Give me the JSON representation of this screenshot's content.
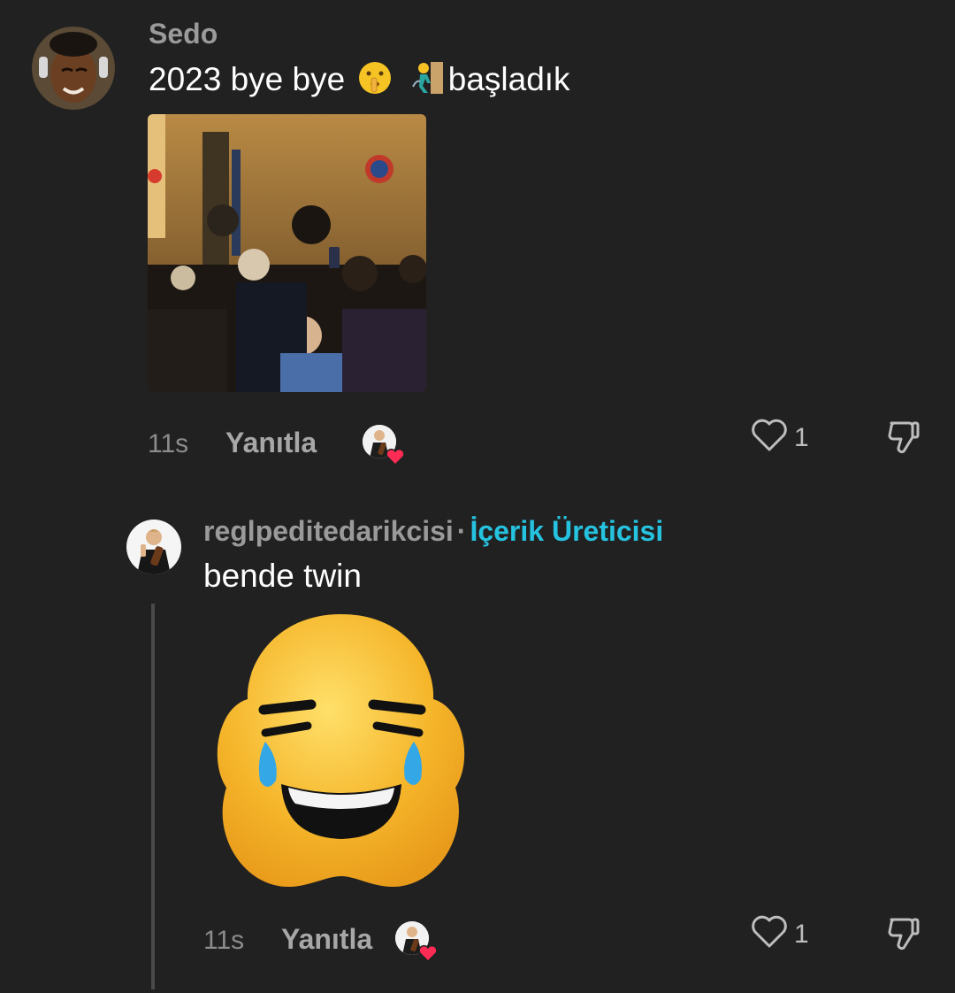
{
  "comments": [
    {
      "username": "Sedo",
      "text_prefix": "2023 bye bye",
      "text_emojis": [
        "shushing-face-emoji",
        "person-climbing-emoji"
      ],
      "text_suffix": "başladık",
      "media": "street-crowd-photo",
      "time": "11s",
      "reply_label": "Yanıtla",
      "like_count": "1",
      "liked_by_creator": true
    },
    {
      "username": "reglpeditedarikcisi",
      "separator": "·",
      "badge": "İçerik Üreticisi",
      "text": "bende twin",
      "media": "laughing-crying-emoji-sticker",
      "time": "11s",
      "reply_label": "Yanıtla",
      "like_count": "1",
      "liked_by_creator": true
    }
  ],
  "colors": {
    "background": "#212121",
    "username": "#9a9a9a",
    "creator_badge": "#25c3e0",
    "heart_badge": "#fe2c55"
  },
  "icons": [
    "heart-outline-icon",
    "thumbs-down-icon",
    "creator-heart-badge-icon"
  ]
}
